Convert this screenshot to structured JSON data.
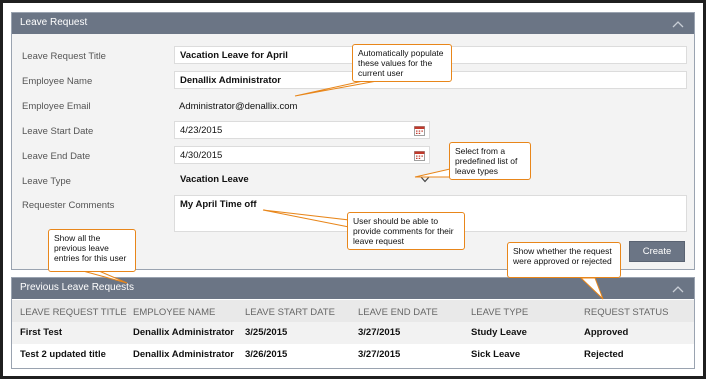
{
  "panel": {
    "title": "Leave Request"
  },
  "form": {
    "labels": {
      "title": "Leave Request Title",
      "employee_name": "Employee Name",
      "employee_email": "Employee Email",
      "start_date": "Leave Start Date",
      "end_date": "Leave End Date",
      "leave_type": "Leave Type",
      "comments": "Requester Comments"
    },
    "values": {
      "title": "Vacation Leave for April",
      "employee_name": "Denallix Administrator",
      "employee_email": "Administrator@denallix.com",
      "start_date": "4/23/2015",
      "end_date": "4/30/2015",
      "leave_type": "Vacation Leave",
      "comments": "My April Time off"
    },
    "create_label": "Create"
  },
  "history": {
    "title": "Previous Leave Requests",
    "columns": [
      "LEAVE REQUEST TITLE",
      "EMPLOYEE NAME",
      "LEAVE START DATE",
      "LEAVE END DATE",
      "LEAVE TYPE",
      "REQUEST STATUS"
    ],
    "rows": [
      [
        "First Test",
        "Denallix Administrator",
        "3/25/2015",
        "3/27/2015",
        "Study Leave",
        "Approved"
      ],
      [
        "Test 2 updated title",
        "Denallix Administrator",
        "3/26/2015",
        "3/27/2015",
        "Sick Leave",
        "Rejected"
      ]
    ]
  },
  "callouts": {
    "autopopulate": "Automatically populate these values for the current user",
    "leave_types": "Select from a predefined list of leave types",
    "comments": "User should be able to provide comments for their leave request",
    "previous": "Show all the previous leave entries for this user",
    "status": "Show whether the request were approved or rejected"
  },
  "colors": {
    "header": "#6b7585",
    "callout_border": "#e8861a",
    "calendar_red": "#c0392b"
  },
  "icons": [
    "chevron-up-icon",
    "calendar-icon",
    "chevron-down-icon"
  ]
}
